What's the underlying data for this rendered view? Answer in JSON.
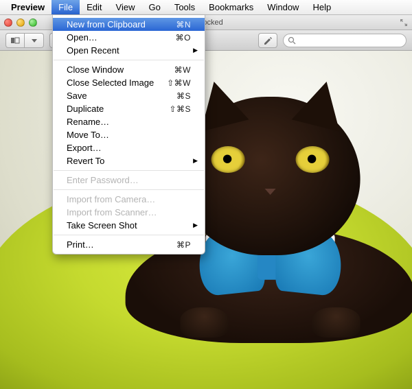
{
  "menubar": {
    "app_name": "Preview",
    "items": [
      "File",
      "Edit",
      "View",
      "Go",
      "Tools",
      "Bookmarks",
      "Window",
      "Help"
    ],
    "active_index": 0
  },
  "window": {
    "title_suffix": "Locked"
  },
  "toolbar": {
    "search_placeholder": ""
  },
  "file_menu": {
    "groups": [
      [
        {
          "label": "New from Clipboard",
          "shortcut": "⌘N",
          "highlight": true
        },
        {
          "label": "Open…",
          "shortcut": "⌘O"
        },
        {
          "label": "Open Recent",
          "submenu": true
        }
      ],
      [
        {
          "label": "Close Window",
          "shortcut": "⌘W"
        },
        {
          "label": "Close Selected Image",
          "shortcut": "⇧⌘W"
        },
        {
          "label": "Save",
          "shortcut": "⌘S"
        },
        {
          "label": "Duplicate",
          "shortcut": "⇧⌘S"
        },
        {
          "label": "Rename…"
        },
        {
          "label": "Move To…"
        },
        {
          "label": "Export…"
        },
        {
          "label": "Revert To",
          "submenu": true
        }
      ],
      [
        {
          "label": "Enter Password…",
          "disabled": true
        }
      ],
      [
        {
          "label": "Import from Camera…",
          "disabled": true
        },
        {
          "label": "Import from Scanner…",
          "disabled": true
        },
        {
          "label": "Take Screen Shot",
          "submenu": true
        }
      ],
      [
        {
          "label": "Print…",
          "shortcut": "⌘P"
        }
      ]
    ]
  }
}
